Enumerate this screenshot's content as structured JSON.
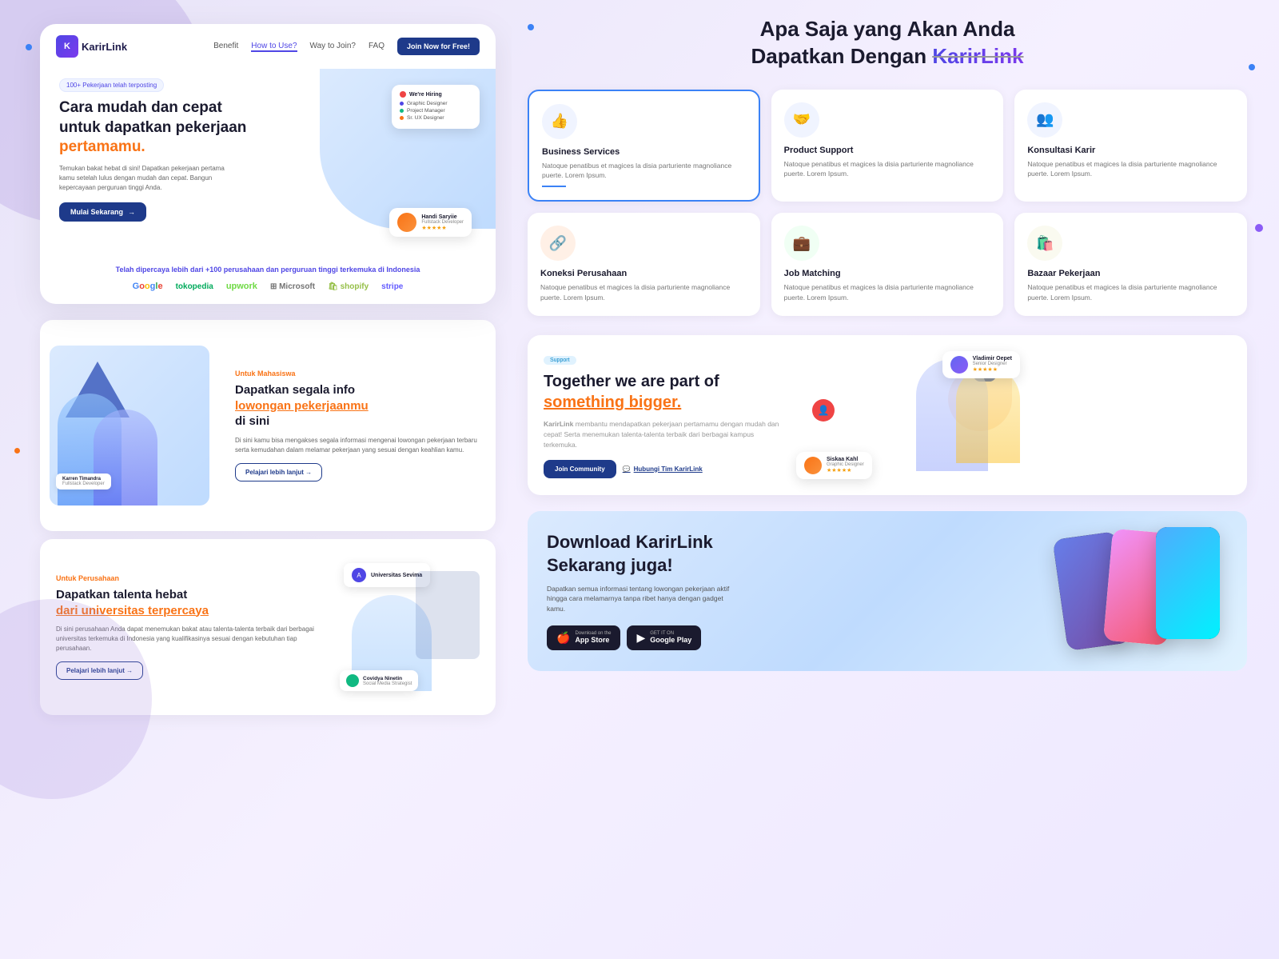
{
  "page": {
    "background": "#f0f0f8"
  },
  "navbar": {
    "logo_text": "KarirLink",
    "nav_items": [
      "Benefit",
      "How to Use?",
      "Way to Join?",
      "FAQ"
    ],
    "active_item": "How to Use?",
    "cta_button": "Join Now for Free!"
  },
  "hero": {
    "badge": "100+ Pekerjaan telah terposting",
    "title_line1": "Cara mudah dan cepat",
    "title_line2": "untuk dapatkan pekerjaan",
    "title_line3": "pertamamu.",
    "description": "Temukan bakat hebat di sini! Dapatkan pekerjaan pertama kamu setelah lulus dengan mudah dan cepat. Bangun kepercayaan perguruan tinggi Anda.",
    "cta_button": "Mulai Sekarang",
    "hiring_card": {
      "title": "We're Hiring",
      "items": [
        "Graphic Designer",
        "Project Manager",
        "Sr. UX Designer"
      ]
    },
    "profile_card": {
      "name": "Handi Saryiie",
      "role": "Fullstack Developer",
      "stars": "★★★★★"
    }
  },
  "trusted": {
    "text_before": "Telah dipercaya lebih dari ",
    "highlight": "+100 perusahaan dan perguruan tinggi",
    "text_after": " terkemuka di Indonesia",
    "brands": [
      "Google",
      "tokopedia",
      "upwork",
      "Microsoft",
      "shopify",
      "stripe"
    ]
  },
  "section_mahasiswa": {
    "tag": "Untuk Mahasiswa",
    "title_line1": "Dapatkan segala info",
    "title_line2": "lowongan pekerjaanmu",
    "title_line3": "di sini",
    "description": "Di sini kamu bisa mengakses segala informasi mengenai lowongan pekerjaan terbaru serta kemudahan dalam melamar pekerjaan yang sesuai dengan keahlian kamu.",
    "cta_button": "Pelajari lebih lanjut →"
  },
  "section_perusahaan": {
    "tag": "Untuk Perusahaan",
    "title_line1": "Dapatkan talenta hebat",
    "title_line2": "dari universitas terpercaya",
    "description": "Di sini perusahaan Anda dapat menemukan bakat atau talenta-talenta terbaik dari berbagai universitas terkemuka di Indonesia yang kualifikasinya sesuai dengan kebutuhan tiap perusahaan.",
    "cta_button": "Pelajari lebih lanjut →",
    "university_card": "Universitas Sevima"
  },
  "features": {
    "heading_line1": "Apa Saja yang Akan Anda",
    "heading_line2": "Dapatkan Dengan",
    "brand_name": "KarirLink",
    "cards": [
      {
        "icon": "👍",
        "name": "Business Services",
        "description": "Natoque penatibus et magices la disia parturiente magnoliance puerte. Lorem Ipsum.",
        "active": true
      },
      {
        "icon": "🤝",
        "name": "Product Support",
        "description": "Natoque penatibus et magices la disia parturiente magnoliance puerte. Lorem Ipsum.",
        "active": false
      },
      {
        "icon": "👥",
        "name": "Konsultasi Karir",
        "description": "Natoque penatibus et magices la disia parturiente magnoliance puerte. Lorem Ipsum.",
        "active": false
      },
      {
        "icon": "🔗",
        "name": "Koneksi Perusahaan",
        "description": "Natoque penatibus et magices la disia parturiente magnoliance puerte. Lorem Ipsum.",
        "active": false
      },
      {
        "icon": "💼",
        "name": "Job Matching",
        "description": "Natoque penatibus et magices la disia parturiente magnoliance puerte. Lorem Ipsum.",
        "active": false
      },
      {
        "icon": "🛍️",
        "name": "Bazaar Pekerjaan",
        "description": "Natoque penatibus et magices la disia parturiente magnoliance puerte. Lorem Ipsum.",
        "active": false
      }
    ]
  },
  "together": {
    "badge": "Support",
    "title_line1": "Together we are part of",
    "title_line2": "something bigger.",
    "description_prefix": "KarirLink",
    "description": " membantu mendapatkan pekerjaan pertamamu dengan mudah dan cepat! Serta menemukan talenta-talenta terbaik dari berbagai kampus terkemuka.",
    "btn_join": "Join Community",
    "btn_contact": "Hubungi Tim KarirLink",
    "person1": {
      "name": "Siskaa Kahl",
      "role": "Graphic Designer",
      "stars": "★★★★★"
    },
    "person2": {
      "name": "Vladimir Oepet",
      "role": "Senior Designer",
      "stars": "★★★★★"
    }
  },
  "download": {
    "title_line1": "Download KarirLink",
    "title_line2": "Sekarang juga!",
    "description": "Dapatkan semua informasi tentang lowongan pekerjaan aktif hingga cara melamarnya tanpa ribet hanya dengan gadget kamu.",
    "app_store": {
      "label_sm": "Download on the",
      "label_lg": "App Store"
    },
    "google_play": {
      "label_sm": "GET IT ON",
      "label_lg": "Google Play"
    }
  }
}
